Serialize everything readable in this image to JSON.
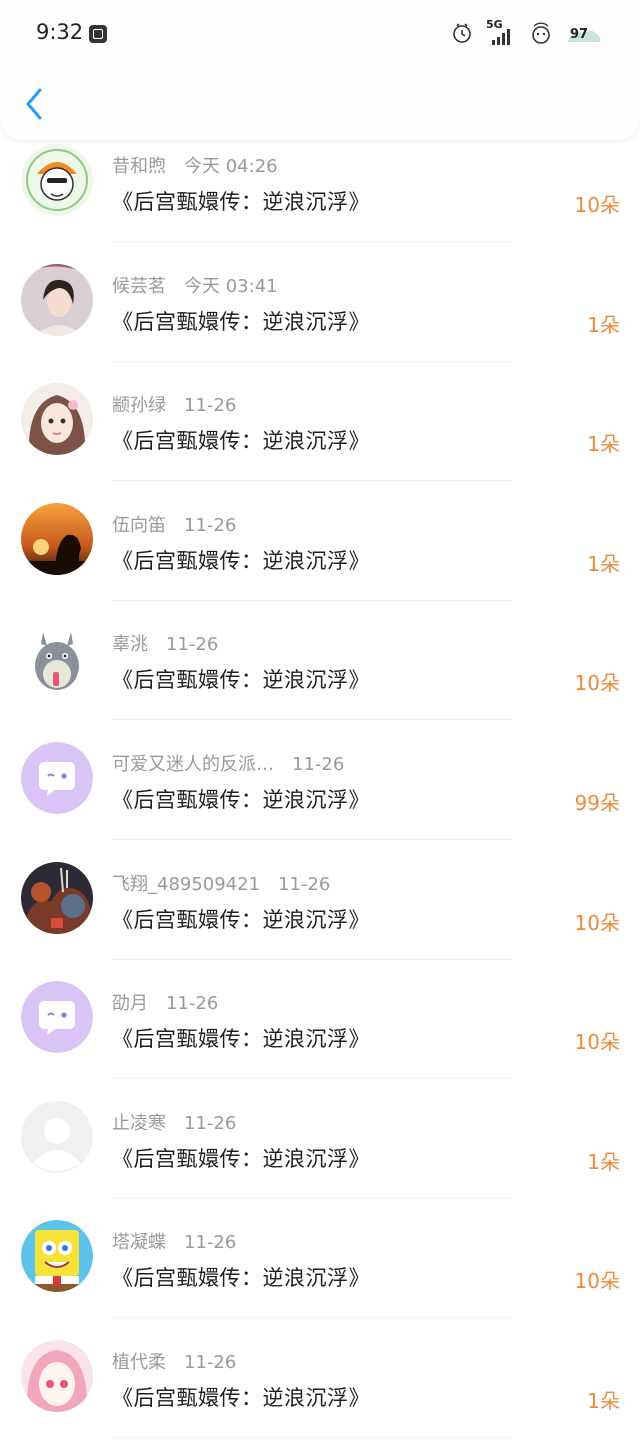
{
  "status_bar": {
    "time": "9:32",
    "network": "5G",
    "battery": "97"
  },
  "nav": {
    "back_icon": "chevron-left-icon"
  },
  "colors": {
    "accent": "#2a9bf5",
    "amount": "#f08a3a",
    "meta_text": "#9a9a9a"
  },
  "gifts": [
    {
      "name": "昔和煦",
      "date": "今天 04:26",
      "title": "《后宫甄嬛传：逆浪沉浮》",
      "amount": "10朵",
      "avatar": "cartoon-character-avatar"
    },
    {
      "name": "候芸茗",
      "date": "今天 03:41",
      "title": "《后宫甄嬛传：逆浪沉浮》",
      "amount": "1朵",
      "avatar": "girl-photo-avatar"
    },
    {
      "name": "颛孙绿",
      "date": "11-26",
      "title": "《后宫甄嬛传：逆浪沉浮》",
      "amount": "1朵",
      "avatar": "girl-selfie-avatar"
    },
    {
      "name": "伍向笛",
      "date": "11-26",
      "title": "《后宫甄嬛传：逆浪沉浮》",
      "amount": "1朵",
      "avatar": "sunset-silhouette-avatar"
    },
    {
      "name": "辜洮",
      "date": "11-26",
      "title": "《后宫甄嬛传：逆浪沉浮》",
      "amount": "10朵",
      "avatar": "totoro-avatar"
    },
    {
      "name": "可爱又迷人的反派…",
      "date": "11-26",
      "title": "《后宫甄嬛传：逆浪沉浮》",
      "amount": "99朵",
      "avatar": "default-chat-avatar"
    },
    {
      "name": "飞翔_489509421",
      "date": "11-26",
      "title": "《后宫甄嬛传：逆浪沉浮》",
      "amount": "10朵",
      "avatar": "game-poster-avatar"
    },
    {
      "name": "劭月",
      "date": "11-26",
      "title": "《后宫甄嬛传：逆浪沉浮》",
      "amount": "10朵",
      "avatar": "default-chat-avatar"
    },
    {
      "name": "止凌寒",
      "date": "11-26",
      "title": "《后宫甄嬛传：逆浪沉浮》",
      "amount": "1朵",
      "avatar": "default-person-avatar"
    },
    {
      "name": "塔凝蝶",
      "date": "11-26",
      "title": "《后宫甄嬛传：逆浪沉浮》",
      "amount": "10朵",
      "avatar": "spongebob-avatar"
    },
    {
      "name": "植代柔",
      "date": "11-26",
      "title": "《后宫甄嬛传：逆浪沉浮》",
      "amount": "1朵",
      "avatar": "anime-girl-avatar"
    }
  ]
}
